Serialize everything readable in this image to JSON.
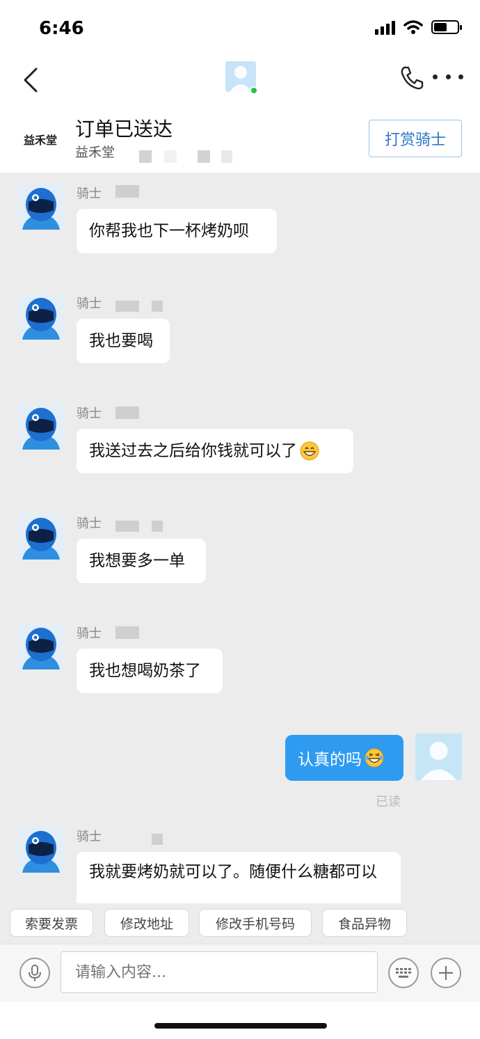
{
  "status_bar": {
    "time": "6:46",
    "battery_level": 0.55
  },
  "header": {
    "contact_online": true
  },
  "order": {
    "status": "订单已送达",
    "shop_logo": "益禾堂",
    "shop_name": "益禾堂",
    "tip_button": "打赏骑士"
  },
  "messages": [
    {
      "sender": "骑士",
      "text": "你帮我也下一杯烤奶呗",
      "emoji": false
    },
    {
      "sender": "骑士",
      "text": "我也要喝",
      "emoji": false
    },
    {
      "sender": "骑士",
      "text": "我送过去之后给你钱就可以了",
      "emoji": true
    },
    {
      "sender": "骑士",
      "text": "我想要多一单",
      "emoji": false
    },
    {
      "sender": "骑士",
      "text": "我也想喝奶茶了",
      "emoji": false
    },
    {
      "sender": "骑士",
      "text": "我就要烤奶就可以了。随便什么糖都可以",
      "emoji": false
    }
  ],
  "outgoing": {
    "text": "认真的吗",
    "emoji": true,
    "read_status": "已读"
  },
  "quick_replies": [
    "索要发票",
    "修改地址",
    "修改手机号码",
    "食品异物"
  ],
  "input": {
    "placeholder": "请输入内容..."
  },
  "icons": {
    "back": "chevron-left-icon",
    "phone": "phone-icon",
    "more": "more-dots-icon",
    "voice": "microphone-icon",
    "keyboard": "keyboard-icon",
    "add": "plus-icon"
  },
  "colors": {
    "accent": "#2e9bf0",
    "tip_button_text": "#2c79c6",
    "chat_bg": "#ececec"
  }
}
